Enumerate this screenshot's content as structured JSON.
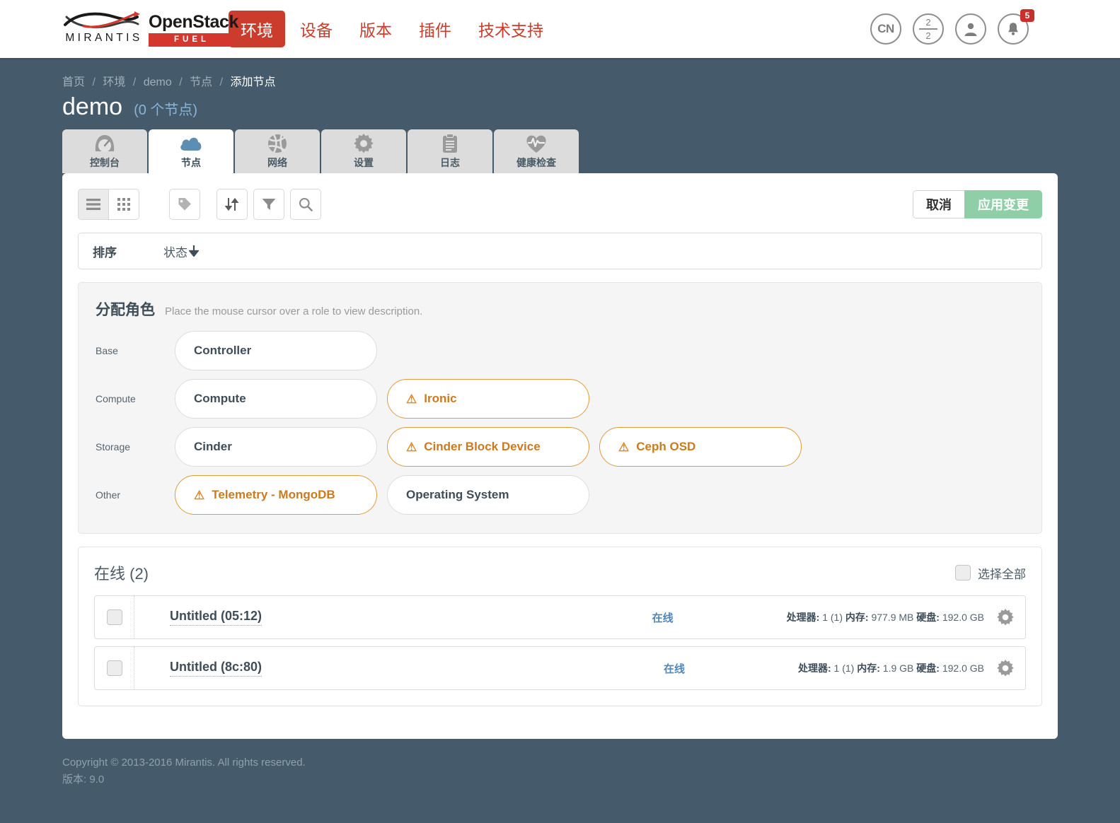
{
  "brand": {
    "mirantis": "MIRANTIS",
    "openstack": "OpenStack",
    "fuel": "FUEL"
  },
  "nav": {
    "links": [
      {
        "label": "环境",
        "active": true
      },
      {
        "label": "设备",
        "active": false
      },
      {
        "label": "版本",
        "active": false
      },
      {
        "label": "插件",
        "active": false
      },
      {
        "label": "技术支持",
        "active": false
      }
    ],
    "lang": "CN",
    "nodes_ratio_num": "2",
    "nodes_ratio_den": "2",
    "notification_count": "5"
  },
  "breadcrumb": {
    "items": [
      "首页",
      "环境",
      "demo",
      "节点",
      "添加节点"
    ],
    "separator": "/"
  },
  "header": {
    "title": "demo",
    "subtitle": "(0 个节点)"
  },
  "tabs": [
    {
      "label": "控制台",
      "icon": "dashboard-icon",
      "active": false
    },
    {
      "label": "节点",
      "icon": "cloud-icon",
      "active": true
    },
    {
      "label": "网络",
      "icon": "network-icon",
      "active": false
    },
    {
      "label": "设置",
      "icon": "gear-icon",
      "active": false
    },
    {
      "label": "日志",
      "icon": "clipboard-icon",
      "active": false
    },
    {
      "label": "健康检查",
      "icon": "heartbeat-icon",
      "active": false
    }
  ],
  "toolbar": {
    "list_view": "list-view-icon",
    "grid_view": "grid-view-icon",
    "label_button": "tag-icon",
    "sort_button": "sort-icon",
    "filter_button": "filter-icon",
    "search_button": "search-icon",
    "cancel_label": "取消",
    "apply_label": "应用变更"
  },
  "sort": {
    "label": "排序",
    "value": "状态",
    "direction": "↓"
  },
  "roles": {
    "title": "分配角色",
    "hint": "Place the mouse cursor over a role to view description.",
    "rows": [
      {
        "category": "Base",
        "items": [
          {
            "label": "Controller",
            "warning": false
          }
        ]
      },
      {
        "category": "Compute",
        "items": [
          {
            "label": "Compute",
            "warning": false
          },
          {
            "label": "Ironic",
            "warning": true
          }
        ]
      },
      {
        "category": "Storage",
        "items": [
          {
            "label": "Cinder",
            "warning": false
          },
          {
            "label": "Cinder Block Device",
            "warning": true
          },
          {
            "label": "Ceph OSD",
            "warning": true
          }
        ]
      },
      {
        "category": "Other",
        "items": [
          {
            "label": "Telemetry - MongoDB",
            "warning": true
          },
          {
            "label": "Operating System",
            "warning": false
          }
        ]
      }
    ]
  },
  "nodes": {
    "group_title": "在线 (2)",
    "select_all_label": "选择全部",
    "rows": [
      {
        "name": "Untitled (05:12)",
        "status": "在线",
        "cpu_label": "处理器:",
        "cpu_value": "1 (1)",
        "ram_label": "内存:",
        "ram_value": "977.9 MB",
        "hdd_label": "硬盘:",
        "hdd_value": "192.0 GB"
      },
      {
        "name": "Untitled (8c:80)",
        "status": "在线",
        "cpu_label": "处理器:",
        "cpu_value": "1 (1)",
        "ram_label": "内存:",
        "ram_value": "1.9 GB",
        "hdd_label": "硬盘:",
        "hdd_value": "192.0 GB"
      }
    ]
  },
  "footer": {
    "copyright": "Copyright © 2013-2016 Mirantis. All rights reserved.",
    "version": "版本: 9.0"
  },
  "colors": {
    "page_bg": "#455b6b",
    "brand_red": "#cc3c2c",
    "apply_green": "#8fcfa7",
    "warning_orange": "#e09b3b",
    "link_blue": "#4e87b8"
  }
}
